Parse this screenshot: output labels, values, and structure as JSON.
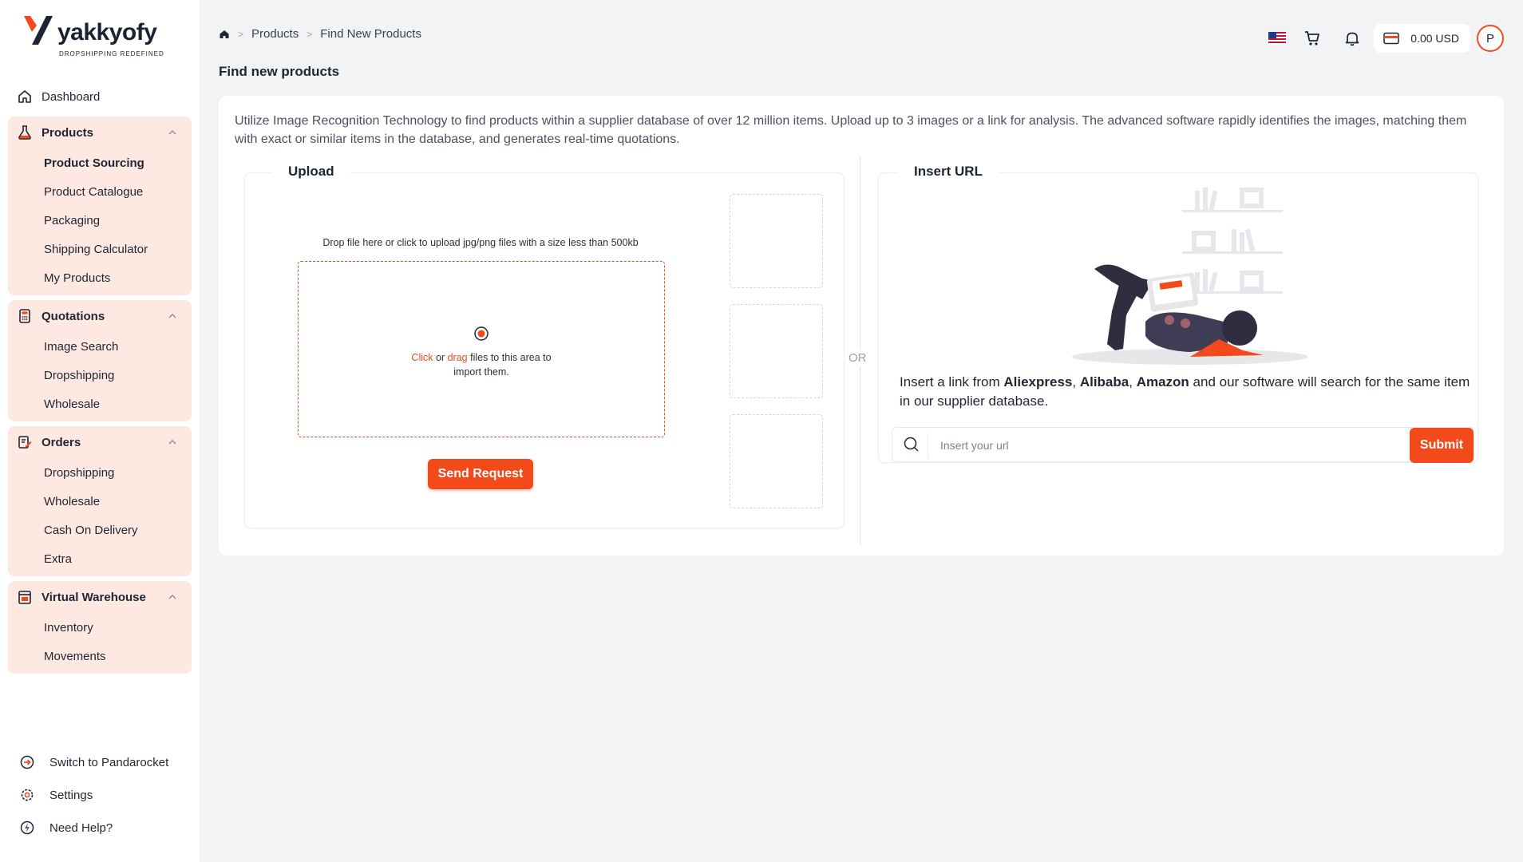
{
  "brand": {
    "name": "yakkyofy",
    "tagline": "DROPSHIPPING REDEFINED",
    "accent": "#f24a1b"
  },
  "sidebar": {
    "dashboard": "Dashboard",
    "groups": [
      {
        "label": "Products",
        "icon": "flask-icon",
        "items": [
          "Product Sourcing",
          "Product Catalogue",
          "Packaging",
          "Shipping Calculator",
          "My Products"
        ],
        "active": "Product Sourcing"
      },
      {
        "label": "Quotations",
        "icon": "calculator-icon",
        "items": [
          "Image Search",
          "Dropshipping",
          "Wholesale"
        ]
      },
      {
        "label": "Orders",
        "icon": "edit-icon",
        "items": [
          "Dropshipping",
          "Wholesale",
          "Cash On Delivery",
          "Extra"
        ]
      },
      {
        "label": "Virtual Warehouse",
        "icon": "warehouse-icon",
        "items": [
          "Inventory",
          "Movements"
        ]
      }
    ],
    "footer": [
      "Switch to Pandarocket",
      "Settings",
      "Need Help?"
    ]
  },
  "header": {
    "breadcrumb": [
      "Products",
      "Find New Products"
    ],
    "balance": "0.00 USD",
    "avatar_initial": "P"
  },
  "page": {
    "title": "Find new products",
    "intro": "Utilize Image Recognition Technology to find products within a supplier database of over 12 million items. Upload up to 3 images or a link for analysis. The advanced software rapidly identifies the images, matching them with exact or similar items in the database, and generates real-time quotations.",
    "upload": {
      "title": "Upload",
      "hint": "Drop file here or click to upload jpg/png files with a size less than 500kb",
      "click": "Click",
      "or_word": "or",
      "drag": "drag",
      "rest": "files to this area to import them.",
      "button": "Send Request"
    },
    "or_label": "OR",
    "url": {
      "title": "Insert URL",
      "desc_prefix": "Insert a link from ",
      "src1": "Aliexpress",
      "comma1": ", ",
      "src2": "Alibaba",
      "comma2": ", ",
      "src3": "Amazon",
      "desc_suffix": " and our software will search for the same item in our supplier database.",
      "placeholder": "Insert your url",
      "button": "Submit"
    }
  }
}
